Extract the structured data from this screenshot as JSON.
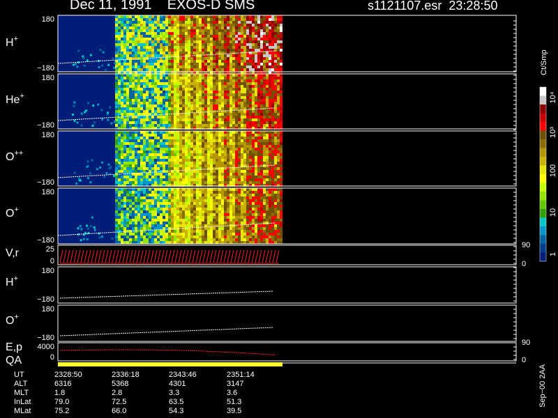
{
  "header": {
    "left_title": "Dec 11, 1991    EXOS-D SMS",
    "right_title": "s1121107.esr  23:28:50"
  },
  "panels": {
    "h_plus": {
      "label": "H",
      "sup": "+",
      "top": "180",
      "bottom": "−180"
    },
    "he_plus": {
      "label": "He",
      "sup": "+",
      "top": "180",
      "bottom": "−180"
    },
    "o_pp": {
      "label": "O",
      "sup": "++",
      "top": "180",
      "bottom": "−180"
    },
    "o_plus": {
      "label": "O",
      "sup": "+",
      "top": "180",
      "bottom": "−180"
    },
    "vr": {
      "label": "V,r",
      "top": "25",
      "bottom": "0",
      "right_top": "90",
      "right_bottom": "0"
    },
    "h_plus2": {
      "label": "H",
      "sup": "+",
      "top": "180",
      "bottom": "−180"
    },
    "o_plus2": {
      "label": "O",
      "sup": "+",
      "top": "180",
      "bottom": "−180"
    },
    "ep": {
      "label": "E,p",
      "top": "4000",
      "bottom": "0",
      "right_top": "90",
      "right_bottom": "0"
    },
    "qa": {
      "label": "QA"
    }
  },
  "colorbar": {
    "unit": "Ct/Smp",
    "labels": [
      "10⁴",
      "10³",
      "100",
      "10",
      "1"
    ],
    "colors": [
      "#ffffff",
      "#c8c8c8",
      "#8c0000",
      "#c80000",
      "#ff0000",
      "#6e5000",
      "#8c6e00",
      "#b49600",
      "#c8b400",
      "#e6e600",
      "#ffff00",
      "#c8ff00",
      "#96e600",
      "#64c800",
      "#32a000",
      "#00c8c8",
      "#0096c8",
      "#0064a0",
      "#003c8c",
      "#001e78"
    ]
  },
  "footer": {
    "rows": [
      {
        "name": "UT",
        "values": [
          "2328:50",
          "2336:18",
          "2343:46",
          "2351:14"
        ]
      },
      {
        "name": "ALT",
        "values": [
          "6316",
          "5368",
          "4301",
          "3147"
        ]
      },
      {
        "name": "MLT",
        "values": [
          "1.8",
          "2.8",
          "3.3",
          "3.6"
        ]
      },
      {
        "name": "InLat",
        "values": [
          "79.0",
          "72.5",
          "63.5",
          "51.3"
        ]
      },
      {
        "name": "MLat",
        "values": [
          "75.2",
          "66.0",
          "54.3",
          "39.5"
        ]
      }
    ],
    "tag": "Sep−00 2AA"
  },
  "chart_data": {
    "type": "heatmap",
    "title": "Dec 11, 1991    EXOS-D SMS",
    "x": [
      "2328:50",
      "2336:18",
      "2343:46",
      "2351:14"
    ],
    "series": [
      {
        "name": "H+",
        "ylim": [
          -180,
          180
        ]
      },
      {
        "name": "He+",
        "ylim": [
          -180,
          180
        ]
      },
      {
        "name": "O++",
        "ylim": [
          -180,
          180
        ]
      },
      {
        "name": "O+",
        "ylim": [
          -180,
          180
        ]
      },
      {
        "name": "V,r",
        "ylim": [
          0,
          25
        ]
      },
      {
        "name": "E,p",
        "ylim": [
          0,
          4000
        ]
      }
    ],
    "colorbar_range": [
      1,
      10000
    ],
    "colorbar_scale": "log"
  }
}
